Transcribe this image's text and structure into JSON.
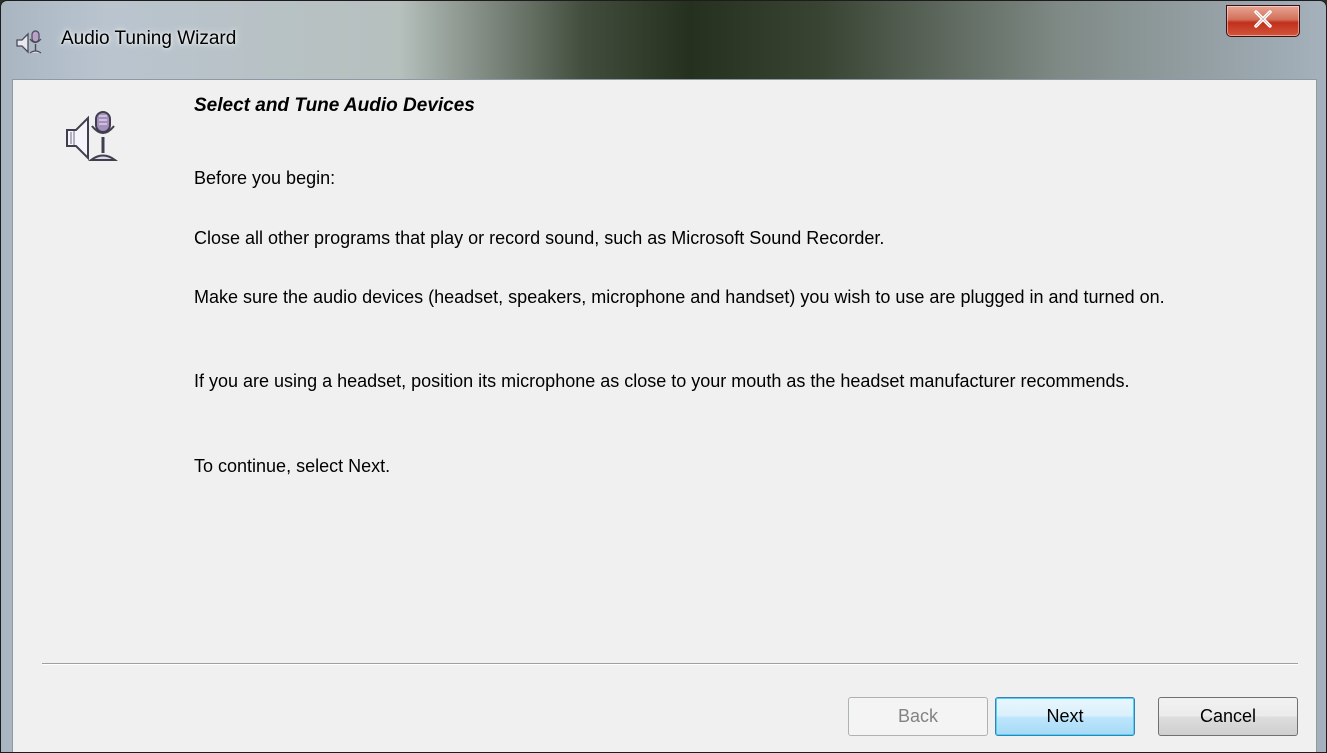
{
  "window": {
    "title": "Audio Tuning Wizard",
    "close_symbol": "x",
    "title_icon": "speaker-microphone-icon"
  },
  "content": {
    "icon": "speaker-microphone-icon",
    "heading": "Select and Tune Audio Devices",
    "intro": "Before you begin:",
    "step_close_programs": "Close all other programs that play or record sound, such as Microsoft Sound Recorder.",
    "step_devices": "Make sure the audio devices (headset, speakers, microphone and handset) you wish to use are plugged in and turned on.",
    "step_headset": "If you are using a headset, position its microphone as close to your mouth as the headset manufacturer recommends.",
    "continue_hint": "To continue, select Next."
  },
  "buttons": {
    "back": "Back",
    "next": "Next",
    "cancel": "Cancel"
  },
  "colors": {
    "close_button": "#c7432a",
    "default_button_border": "#3c7fb1",
    "client_background": "#f0f0f0"
  }
}
